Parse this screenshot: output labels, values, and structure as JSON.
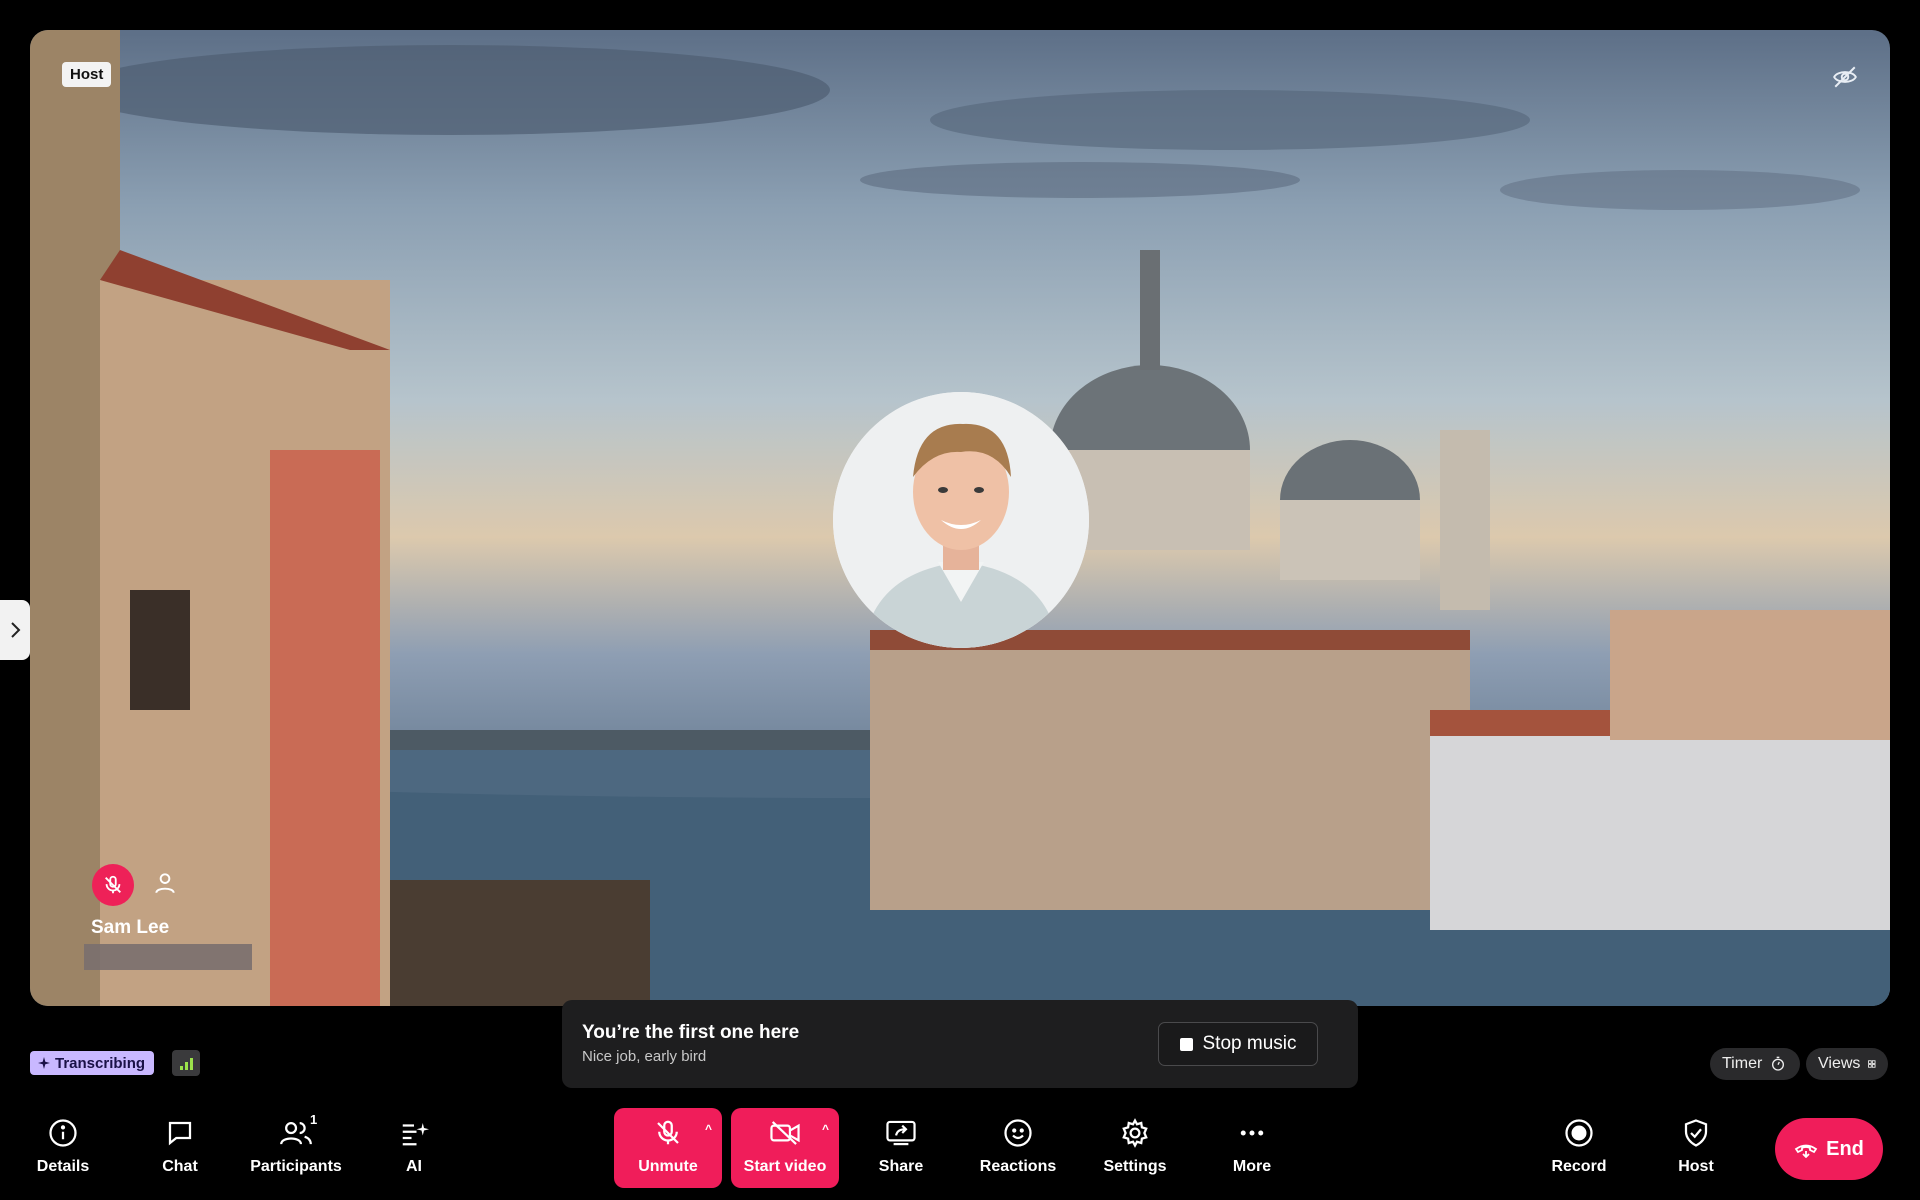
{
  "stage": {
    "host_tag": "Host",
    "participant_name": "Sam Lee"
  },
  "toast": {
    "title": "You’re the first one here",
    "subtitle": "Nice job, early bird",
    "stop_music_label": "Stop music"
  },
  "status": {
    "transcribing_label": "Transcribing",
    "timer_label": "Timer",
    "views_label": "Views"
  },
  "toolbar": {
    "details": "Details",
    "chat": "Chat",
    "participants": "Participants",
    "participants_count": "1",
    "ai": "AI",
    "unmute": "Unmute",
    "start_video": "Start video",
    "share": "Share",
    "reactions": "Reactions",
    "settings": "Settings",
    "more": "More",
    "record": "Record",
    "host": "Host",
    "end": "End"
  },
  "colors": {
    "accent_red": "#f01d5a",
    "transcribing_bg": "#c9b8ff",
    "signal_green": "#9be24b"
  }
}
